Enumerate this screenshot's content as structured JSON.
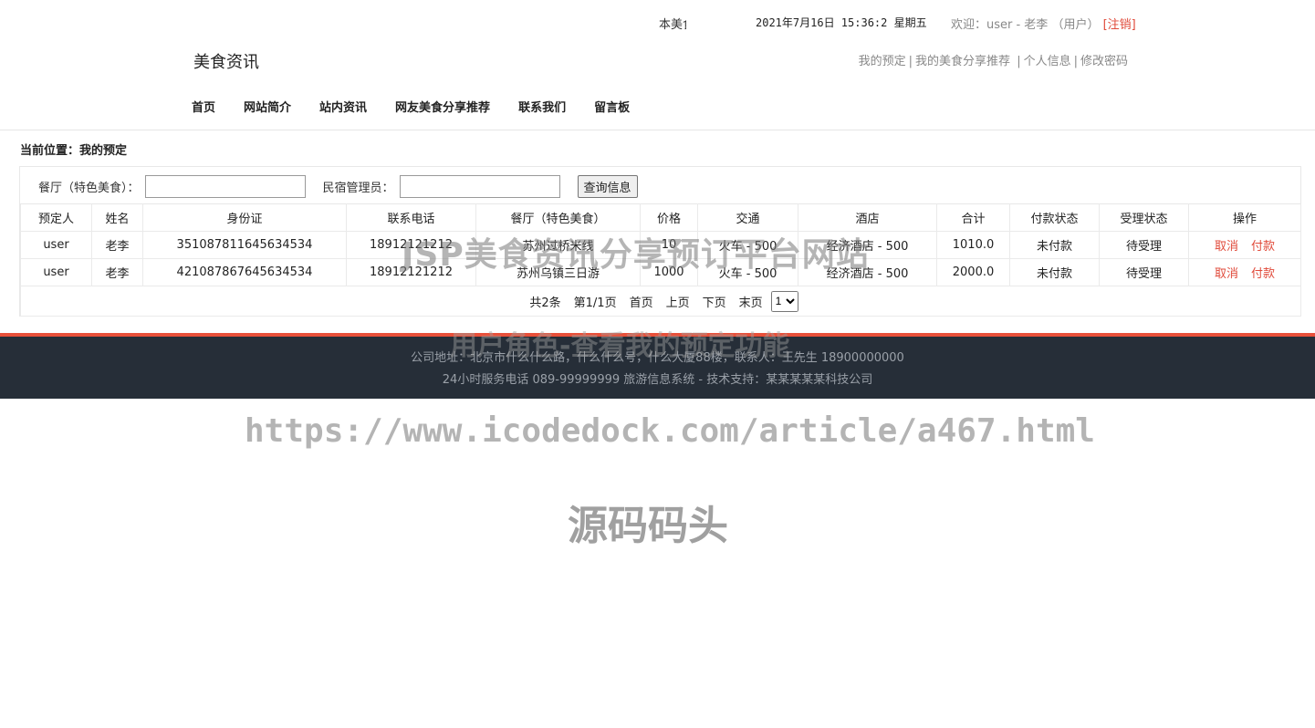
{
  "topbar": {
    "marquee": "本美食",
    "datetime": "2021年7月16日 15:36:2 星期五",
    "welcome": "欢迎：user - 老李 （用户）",
    "logout": "[注销]"
  },
  "site": {
    "brand": "美食资讯"
  },
  "userlinks": [
    "我的预定",
    "我的美食分享推荐",
    "个人信息",
    "修改密码"
  ],
  "nav": [
    "首页",
    "网站简介",
    "站内资讯",
    "网友美食分享推荐",
    "联系我们",
    "留言板"
  ],
  "breadcrumb": "当前位置：我的预定",
  "search": {
    "restaurant_label": "餐厅（特色美食）：",
    "restaurant_value": "",
    "manager_label": "民宿管理员：",
    "manager_value": "",
    "button": "查询信息"
  },
  "table": {
    "headers": [
      "预定人",
      "姓名",
      "身份证",
      "联系电话",
      "餐厅（特色美食）",
      "价格",
      "交通",
      "酒店",
      "合计",
      "付款状态",
      "受理状态",
      "操作"
    ],
    "rows": [
      [
        "user",
        "老李",
        "351087811645634534",
        "18912121212",
        "苏州过桥米线",
        "10",
        "火车 - 500",
        "经济酒店 - 500",
        "1010.0",
        "未付款",
        "待受理"
      ],
      [
        "user",
        "老李",
        "421087867645634534",
        "18912121212",
        "苏州乌镇三日游",
        "1000",
        "火车 - 500",
        "经济酒店 - 500",
        "2000.0",
        "未付款",
        "待受理"
      ]
    ],
    "op_cancel": "取消",
    "op_pay": "付款"
  },
  "pager": {
    "total": "共2条",
    "page": "第1/1页",
    "first": "首页",
    "prev": "上页",
    "next": "下页",
    "last": "末页",
    "selected": "1"
  },
  "footer": {
    "line1": "公司地址：北京市什么什么路，什么什么号，什么大厦88楼，联系人：王先生 18900000000",
    "line2": "24小时服务电话   089-99999999   旅游信息系统 - 技术支持：某某某某某科技公司"
  },
  "watermarks": {
    "title": "JSP美食资讯分享预订平台网站",
    "subtitle": "用户角色-查看我的预定功能",
    "url": "https://www.icodedock.com/article/a467.html",
    "brand": "源码码头"
  },
  "colors": {
    "accent": "#e04a3a",
    "footer_bg": "#262e38",
    "footer_border": "#e8503a"
  }
}
